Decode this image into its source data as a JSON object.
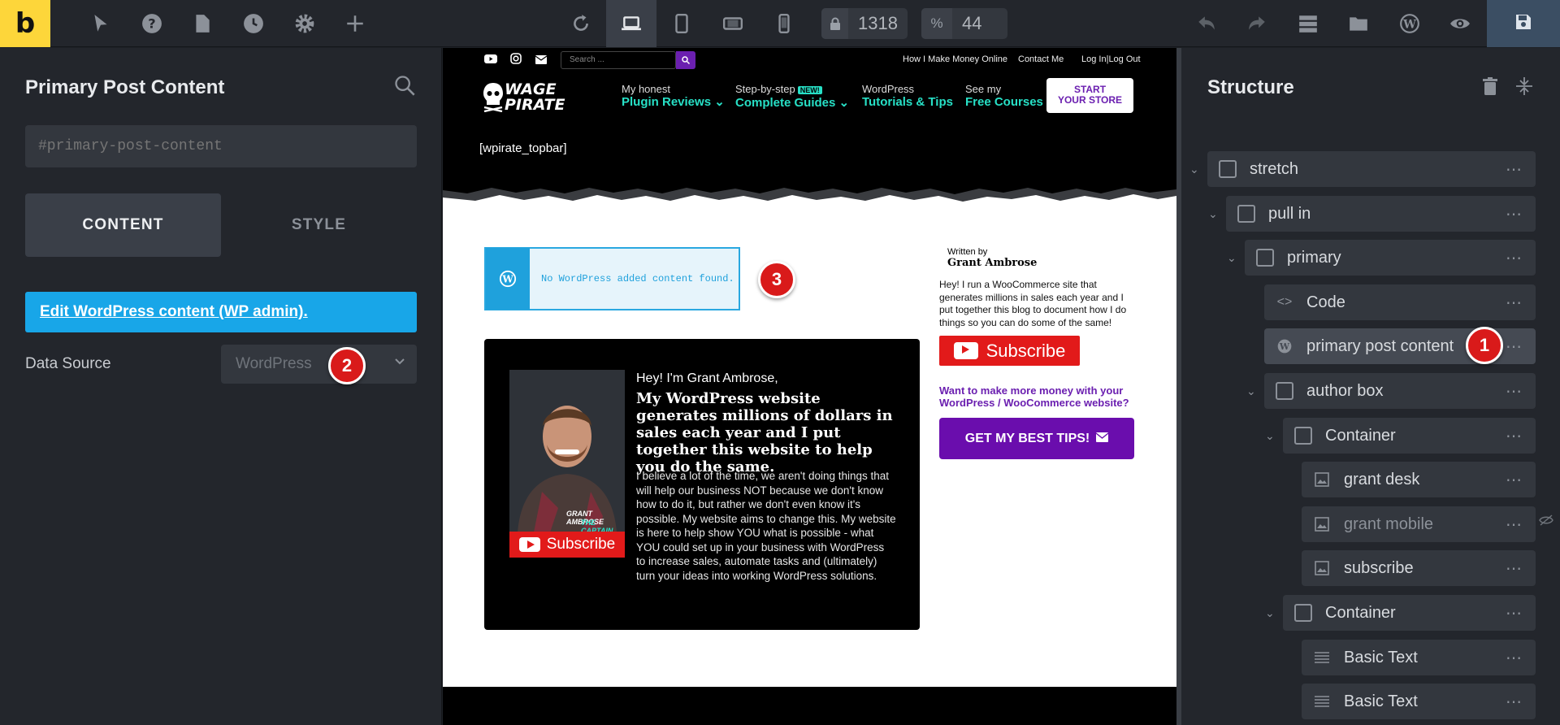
{
  "toolbar": {
    "logo": "b",
    "width_value": "1318",
    "scale_prefix": "%",
    "scale_value": "44",
    "icons": [
      "cursor-icon",
      "help-icon",
      "pages-icon",
      "history-icon",
      "settings-icon",
      "add-icon",
      "refresh-icon",
      "desktop-icon",
      "tablet-icon",
      "tablet-landscape-icon",
      "mobile-icon",
      "undo-icon",
      "redo-icon",
      "layers-icon",
      "folder-icon",
      "wordpress-icon",
      "preview-icon",
      "save-icon"
    ]
  },
  "left_panel": {
    "title": "Primary Post Content",
    "css_id_placeholder": "#primary-post-content",
    "tabs": [
      "CONTENT",
      "STYLE"
    ],
    "edit_link": "Edit WordPress content (WP admin).",
    "data_source_label": "Data Source",
    "data_source_value": "WordPress"
  },
  "badges": [
    "1",
    "2",
    "3"
  ],
  "site": {
    "search_placeholder": "Search ...",
    "top_links": [
      "How I Make Money Online",
      "Contact Me",
      "Log In|Log Out"
    ],
    "brand_line1": "WAGE",
    "brand_line2": "PIRATE",
    "nav": [
      {
        "small": "My honest",
        "big": "Plugin Reviews ⌄"
      },
      {
        "small": "Step-by-step",
        "tag": "NEW!",
        "big": "Complete Guides ⌄"
      },
      {
        "small": "WordPress",
        "big": "Tutorials & Tips"
      },
      {
        "small": "See my",
        "big": "Free Courses"
      }
    ],
    "store_btn_line1": "START",
    "store_btn_line2": "YOUR STORE",
    "shortcode": "[wpirate_topbar]",
    "no_content_msg": "No WordPress added content found.",
    "author_box": {
      "hey": "Hey! I'm Grant Ambrose,",
      "headline": "My WordPress website generates millions of dollars in sales each year and I put together this website to help you do the same.",
      "body": "I believe a lot of the time, we aren't doing things that will help our business NOT because we don't know how to do it, but rather we don't even know it's possible. My website aims to change this. My website is here to help show YOU what is possible - what YOU could set up in your business with WordPress to increase sales, automate tasks and (ultimately) turn your ideas into working WordPress solutions.",
      "photo_caption_line1": "GRANT AMBROSE",
      "photo_caption_line2": "THE CAPTAIN",
      "subscribe": "Subscribe"
    },
    "sidebar": {
      "written_by": "Written by",
      "author": "Grant Ambrose",
      "text": "Hey! I run a WooCommerce site that generates millions in sales each year and I put together this blog to document how I do things so you can do some of the same!",
      "subscribe": "Subscribe",
      "question": "Want to make more money with your WordPress / WooCommerce website?",
      "cta": "GET MY BEST TIPS!"
    }
  },
  "structure": {
    "title": "Structure",
    "nodes": [
      {
        "label": "stretch",
        "icon": "checkbox"
      },
      {
        "label": "pull in",
        "icon": "checkbox"
      },
      {
        "label": "primary",
        "icon": "checkbox"
      },
      {
        "label": "Code",
        "icon": "code-icon"
      },
      {
        "label": "primary post content",
        "icon": "wordpress-icon"
      },
      {
        "label": "author box",
        "icon": "checkbox"
      },
      {
        "label": "Container",
        "icon": "checkbox"
      },
      {
        "label": "grant desk",
        "icon": "image-icon"
      },
      {
        "label": "grant mobile",
        "icon": "image-icon"
      },
      {
        "label": "subscribe",
        "icon": "image-icon"
      },
      {
        "label": "Container",
        "icon": "checkbox"
      },
      {
        "label": "Basic Text",
        "icon": "text-icon"
      },
      {
        "label": "Basic Text",
        "icon": "text-icon"
      }
    ]
  },
  "colors": {
    "brand_yellow": "#fdd63a",
    "wp_blue": "#18a6e8",
    "badge_red": "#d91a1a",
    "accent_teal": "#27e0c6",
    "accent_purple": "#6a0dad"
  }
}
